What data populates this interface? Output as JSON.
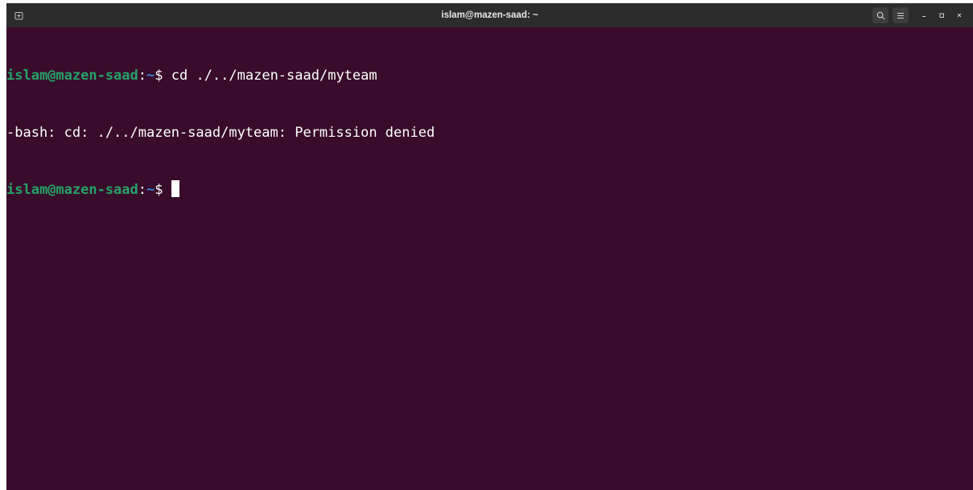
{
  "window": {
    "title": "islam@mazen-saad: ~"
  },
  "terminal": {
    "lines": [
      {
        "user_host": "islam@mazen-saad",
        "separator": ":",
        "path": "~",
        "prompt_symbol": "$",
        "command": " cd ./../mazen-saad/myteam"
      },
      {
        "output": "-bash: cd: ./../mazen-saad/myteam: Permission denied"
      },
      {
        "user_host": "islam@mazen-saad",
        "separator": ":",
        "path": "~",
        "prompt_symbol": "$",
        "command": " "
      }
    ]
  },
  "colors": {
    "background": "#380c2a",
    "user_host": "#26a269",
    "path": "#3b83dd",
    "text": "#ffffff",
    "titlebar": "#2c2c2c"
  },
  "icons": {
    "new_tab": "new-tab-icon",
    "search": "search-icon",
    "menu": "hamburger-menu-icon",
    "minimize": "minimize-icon",
    "maximize": "maximize-icon",
    "close": "close-icon"
  }
}
